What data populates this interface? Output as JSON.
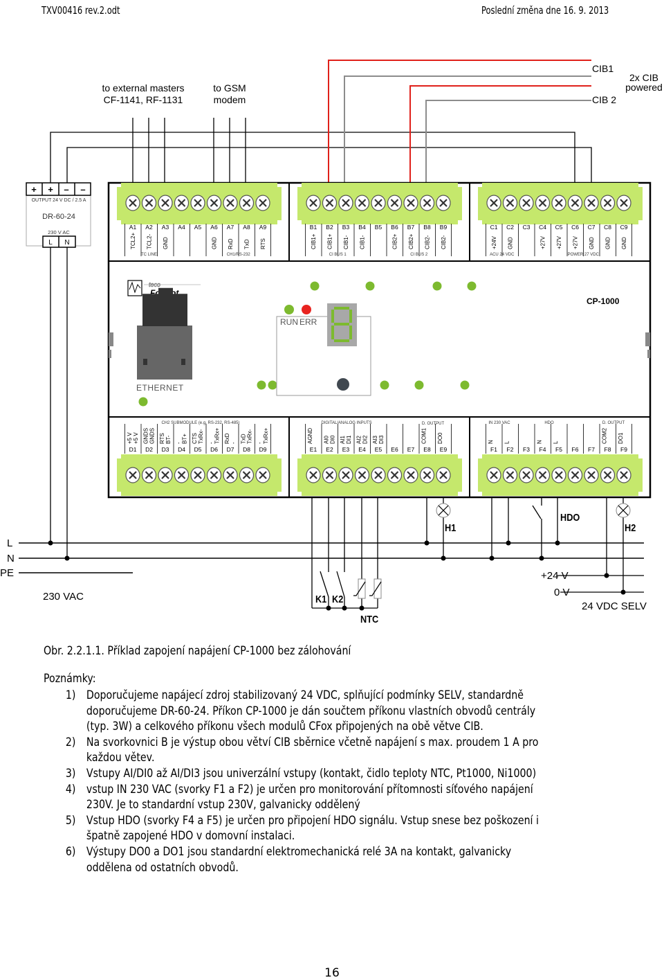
{
  "header": {
    "doc_id": "TXV00416  rev.2.odt",
    "last_change": "Poslední změna dne 16. 9. 2013"
  },
  "diagram": {
    "top_labels": {
      "masters_line1": "to external masters",
      "masters_line2": "CF-1141, RF-1131",
      "gsm_line1": "to GSM",
      "gsm_line2": "modem",
      "cib1": "CIB1",
      "cib2": "CIB 2",
      "cib_powered_line1": "2x CIB",
      "cib_powered_line2": "powered"
    },
    "power_supply": {
      "terminals": [
        "+",
        "+",
        "–",
        "–"
      ],
      "output": "OUTPUT  24 V DC / 2.5 A",
      "model": "DR-60-24",
      "input": "230 V AC",
      "input_terminals": [
        "L",
        "N"
      ]
    },
    "colors": {
      "terminal_green": "#c5e86c",
      "led_green": "#7dba2f",
      "led_red": "#e8231f",
      "wire_red": "#e0201a",
      "wire_gray": "#8c8c8c"
    },
    "module": {
      "model": "CP-1000",
      "brand_top": "teco",
      "brand": "Foxtrot",
      "run_label": "RUN",
      "err_label": "ERR",
      "ethernet_label": "ETHERNET",
      "blocks_top": [
        {
          "terminals": [
            "A1",
            "A2",
            "A3",
            "A4",
            "A5",
            "A6",
            "A7",
            "A8",
            "A9"
          ],
          "signals": [
            "TCL2+",
            "TCL2-",
            "GND",
            "",
            "",
            "GND",
            "RxD",
            "TxD",
            "RTS"
          ],
          "groups": [
            {
              "label": "TC LINE",
              "from": 0,
              "to": 2
            },
            {
              "label": "CH1/RS-232",
              "from": 5,
              "to": 8
            }
          ]
        },
        {
          "terminals": [
            "B1",
            "B2",
            "B3",
            "B4",
            "B5",
            "B6",
            "B7",
            "B8",
            "B9"
          ],
          "signals": [
            "CIB1+",
            "CIB1+",
            "CIB1-",
            "CIB1-",
            "",
            "CIB2+",
            "CIB2+",
            "CIB2-",
            "CIB2-"
          ],
          "groups": [
            {
              "label": "CI BUS 1",
              "from": 0,
              "to": 3
            },
            {
              "label": "CI BUS 2",
              "from": 5,
              "to": 8
            }
          ]
        },
        {
          "terminals": [
            "C1",
            "C2",
            "C3",
            "C4",
            "C5",
            "C6",
            "C7",
            "C8",
            "C9"
          ],
          "signals": [
            "+24V",
            "GND",
            "",
            "+27V",
            "+27V",
            "+27V",
            "GND",
            "GND",
            "GND"
          ],
          "groups": [
            {
              "label": "ACU 24 VDC",
              "from": 0,
              "to": 1
            },
            {
              "label": "POWER 27 VDC",
              "from": 3,
              "to": 8
            }
          ]
        }
      ],
      "blocks_bottom": [
        {
          "title": "CH2  SUBMODULE (e.g. RS-232, RS-485)",
          "terminals": [
            "D1",
            "D2",
            "D3",
            "D4",
            "D5",
            "D6",
            "D7",
            "D8",
            "D9"
          ],
          "signals": [
            [
              "+5 V",
              "+5 V"
            ],
            [
              "GNDS",
              "GNDS"
            ],
            [
              "RTS",
              "BT-"
            ],
            [
              "-",
              "BT+"
            ],
            [
              "CTS",
              "TxRx-"
            ],
            [
              "-",
              "TxRx+"
            ],
            [
              "RxD",
              "-"
            ],
            [
              "TxD",
              "TxRx-"
            ],
            [
              "-",
              "TxRx+"
            ]
          ]
        },
        {
          "title": "DIGITAL/ANALOG INPUTS",
          "title2": "D. OUTPUT",
          "terminals": [
            "E1",
            "E2",
            "E3",
            "E4",
            "E5",
            "E6",
            "E7",
            "E8",
            "E9"
          ],
          "signals": [
            [
              "AGND"
            ],
            [
              "AI0",
              "DI0"
            ],
            [
              "AI1",
              "DI1"
            ],
            [
              "AI2",
              "DI2"
            ],
            [
              "AI3",
              "DI3"
            ],
            [],
            [],
            [
              "COM1"
            ],
            [
              "DO0"
            ]
          ]
        },
        {
          "title": "IN 230 VAC",
          "title_hdo": "HDO",
          "title2": "D. OUTPUT",
          "terminals": [
            "F1",
            "F2",
            "F3",
            "F4",
            "F5",
            "F6",
            "F7",
            "F8",
            "F9"
          ],
          "signals": [
            [
              "N"
            ],
            [
              "L"
            ],
            [],
            [
              "N"
            ],
            [
              "L"
            ],
            [],
            [],
            [
              "COM2"
            ],
            [
              "DO1"
            ]
          ]
        }
      ]
    },
    "wiring": {
      "rails": [
        "L",
        "N",
        "PE"
      ],
      "mains_label": "230 VAC",
      "h1": "H1",
      "h2": "H2",
      "hdo": "HDO",
      "k1": "K1",
      "k2": "K2",
      "ntc": "NTC",
      "plus24": "+24 V",
      "zero": "0 V",
      "selv": "24 VDC SELV"
    }
  },
  "caption": "Obr. 2.2.1.1. Příklad zapojení napájení CP-1000 bez zálohování",
  "notes": {
    "title": "Poznámky:",
    "items": [
      {
        "num": "1)",
        "text": "Doporučujeme napájecí zdroj stabilizovaný 24 VDC, splňující podmínky SELV, standardně\ndoporučujeme DR-60-24. Příkon CP-1000 je dán součtem příkonu vlastních obvodů centrály\n(typ. 3W) a celkového příkonu všech modulů CFox připojených na obě větve CIB."
      },
      {
        "num": "2)",
        "text": "Na svorkovnici B je výstup obou větví CIB sběrnice včetně napájení s max. proudem 1 A pro\nkaždou větev."
      },
      {
        "num": "3)",
        "text": "Vstupy AI/DI0 až AI/DI3 jsou univerzální vstupy (kontakt, čidlo teploty NTC, Pt1000, Ni1000)"
      },
      {
        "num": "4)",
        "text": "vstup IN 230 VAC (svorky F1 a F2) je určen pro monitorování přítomnosti síťového napájení\n230V. Je to standardní vstup 230V, galvanicky oddělený"
      },
      {
        "num": "5)",
        "text": "Vstup HDO (svorky F4 a F5) je určen pro připojení HDO signálu. Vstup snese bez poškození i\nšpatně zapojené HDO v domovní instalaci."
      },
      {
        "num": "6)",
        "text": "Výstupy DO0 a DO1 jsou standardní elektromechanická relé 3A na kontakt, galvanicky\noddělena od ostatních obvodů."
      }
    ]
  },
  "page_number": "16"
}
